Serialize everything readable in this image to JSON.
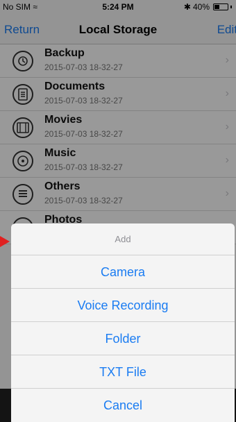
{
  "status_bar": {
    "carrier": "No SIM",
    "wifi_icon": "wifi-icon",
    "time": "5:24 PM",
    "bluetooth_icon": "bluetooth-icon",
    "battery_text": "40%",
    "battery_level": 0.4
  },
  "nav": {
    "left_label": "Return",
    "title": "Local Storage",
    "right_label": "Edit"
  },
  "files": [
    {
      "name": "Backup",
      "date": "2015-07-03 18-32-27",
      "icon": "backup-icon"
    },
    {
      "name": "Documents",
      "date": "2015-07-03 18-32-27",
      "icon": "documents-icon"
    },
    {
      "name": "Movies",
      "date": "2015-07-03 18-32-27",
      "icon": "movies-icon"
    },
    {
      "name": "Music",
      "date": "2015-07-03 18-32-27",
      "icon": "music-icon"
    },
    {
      "name": "Others",
      "date": "2015-07-03 18-32-27",
      "icon": "others-icon"
    },
    {
      "name": "Photos",
      "date": "",
      "icon": "photos-icon"
    }
  ],
  "action_sheet": {
    "title": "Add",
    "options": [
      "Camera",
      "Voice Recording",
      "Folder",
      "TXT File"
    ],
    "cancel": "Cancel"
  },
  "colors": {
    "accent": "#1a7cf2",
    "marker": "#e02020"
  }
}
